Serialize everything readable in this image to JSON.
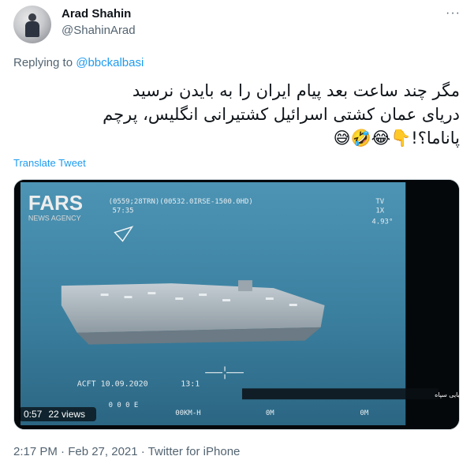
{
  "author": {
    "name": "Arad Shahin",
    "handle": "@ShahinArad"
  },
  "more_icon": "ellipsis-icon",
  "reply": {
    "prefix": "Replying to ",
    "to": "@bbckalbasi"
  },
  "tweet": {
    "line1": "مگر چند ساعت بعد پیام ایران را به بایدن نرسید",
    "line2": "دریای عمان کشتی اسرائیل کشتیرانی انگلیس، پرچم",
    "line3": "پاناما؟!👇😂🤣😅"
  },
  "translate_label": "Translate Tweet",
  "video": {
    "duration": "0:57",
    "views": "22 views",
    "watermark_top": "FARS",
    "watermark_bottom": "NEWS AGENCY",
    "hud_top": "(0559;28TRN)(00532.0IRSE-1500.0HD)",
    "hud_time": "57:35",
    "hud_tv": "TV",
    "hud_1x": "1X",
    "hud_493": "4.93°",
    "hud_date": "ACFT 10.09.2020",
    "hud_clock": "13:1",
    "hud_b1": "0 0 0 E",
    "hud_b2": "00KM-H",
    "hud_b3": "0M",
    "hud_b4": "0M",
    "subtitle": "زمین بر هواپیما و آمریکا توسط پهپادهای نیروی دریایی سپاه"
  },
  "timestamp": "2:17 PM · Feb 27, 2021 · Twitter for iPhone"
}
